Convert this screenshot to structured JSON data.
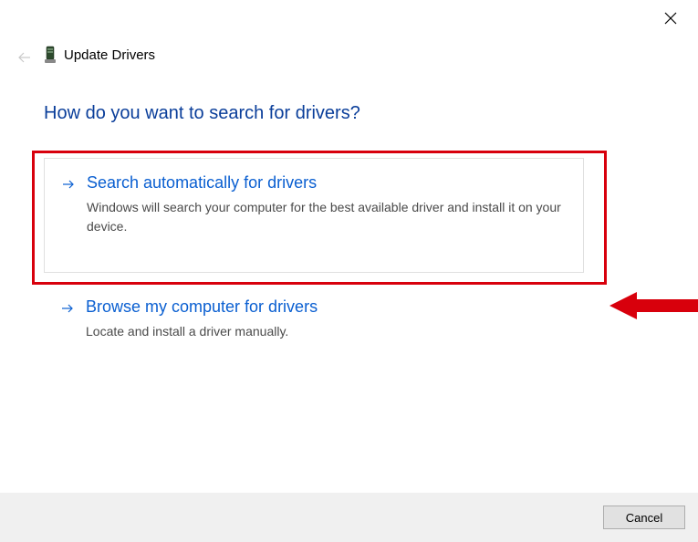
{
  "window": {
    "title": "Update Drivers"
  },
  "heading": "How do you want to search for drivers?",
  "options": [
    {
      "title": "Search automatically for drivers",
      "desc": "Windows will search your computer for the best available driver and install it on your device."
    },
    {
      "title": "Browse my computer for drivers",
      "desc": "Locate and install a driver manually."
    }
  ],
  "footer": {
    "cancel": "Cancel"
  }
}
